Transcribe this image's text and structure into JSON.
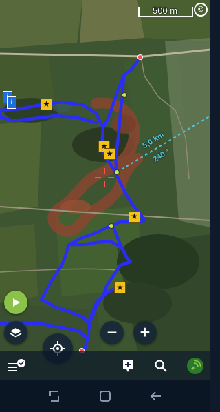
{
  "map": {
    "scale_label": "500 m",
    "copyright_symbol": "©",
    "distance_label": "5,0 km",
    "bearing_label": "240 °",
    "route_color": "#2a2ef2",
    "guide_line_color": "#4fc3d9",
    "crosshair_color": "#ff5050"
  },
  "markers": {
    "info_icon": "info-pin-icon",
    "poi_icon": "star-pin-icon",
    "waypoint_icon": "dot-waypoint-icon"
  },
  "controls": {
    "play_icon": "play-icon",
    "layers_icon": "layers-icon",
    "locate_icon": "locate-crosshair-icon",
    "zoom_out_label": "−",
    "zoom_in_label": "+"
  },
  "toolbar": {
    "menu_icon": "menu-check-icon",
    "add_icon": "add-note-icon",
    "search_icon": "search-icon",
    "gps_icon": "gps-signal-icon"
  },
  "navbar": {
    "back_icon": "back-icon",
    "home_icon": "home-icon",
    "recents_icon": "recents-icon"
  }
}
